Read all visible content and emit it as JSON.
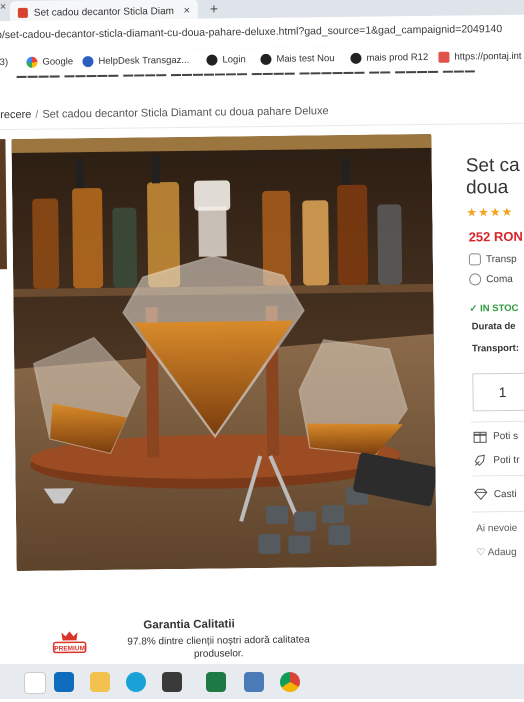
{
  "browser": {
    "tab_title": "Set cadou decantor Sticla Diam",
    "tab_close": "×",
    "new_tab": "+",
    "window_close": "×",
    "url": "p/set-cadou-decantor-sticla-diamant-cu-doua-pahare-deluxe.html?gad_source=1&gad_campaignid=2049140"
  },
  "bookmarks": [
    {
      "label": "(3)",
      "icon": "youtube-icon",
      "color": "#e0302b"
    },
    {
      "label": "Google",
      "icon": "google-icon",
      "color": "#4285f4"
    },
    {
      "label": "HelpDesk Transgaz...",
      "icon": "helpdesk-icon",
      "color": "#2b5fbf"
    },
    {
      "label": "Login",
      "icon": "login-icon",
      "color": "#222222"
    },
    {
      "label": "Mais test Nou",
      "icon": "mais-icon",
      "color": "#222222"
    },
    {
      "label": "mais prod R12",
      "icon": "mais-prod-icon",
      "color": "#222222"
    },
    {
      "label": "https://pontaj.int",
      "icon": "pontaj-icon",
      "color": "#e2524a"
    }
  ],
  "breadcrumb": {
    "first": "trecere",
    "separator": "/",
    "current": "Set cadou decantor Sticla Diamant cu doua pahare Deluxe"
  },
  "product": {
    "title_line1": "Set ca",
    "title_line2": "doua",
    "stars": "★★★★",
    "price": "252 RON",
    "transport": "Transp",
    "comanda": "Coma",
    "in_stock": "✓ IN STOC",
    "durata_label": "Durata de",
    "transport_label": "Transport:",
    "quantity": "1",
    "actions": {
      "poti1": "Poti s",
      "poti2": "Poti tr",
      "cast": "Casti"
    },
    "need_help": "Ai nevoie",
    "wishlist": "♡ Adaug"
  },
  "guarantee": {
    "title": "Garantia Calitatii",
    "text": "97.8% dintre clienții noștri adoră calitatea produselor.",
    "badge_text": "PREMIUM"
  },
  "colors": {
    "price": "#d7262c",
    "stock": "#2f9a3d",
    "stars": "#f3a21b"
  }
}
